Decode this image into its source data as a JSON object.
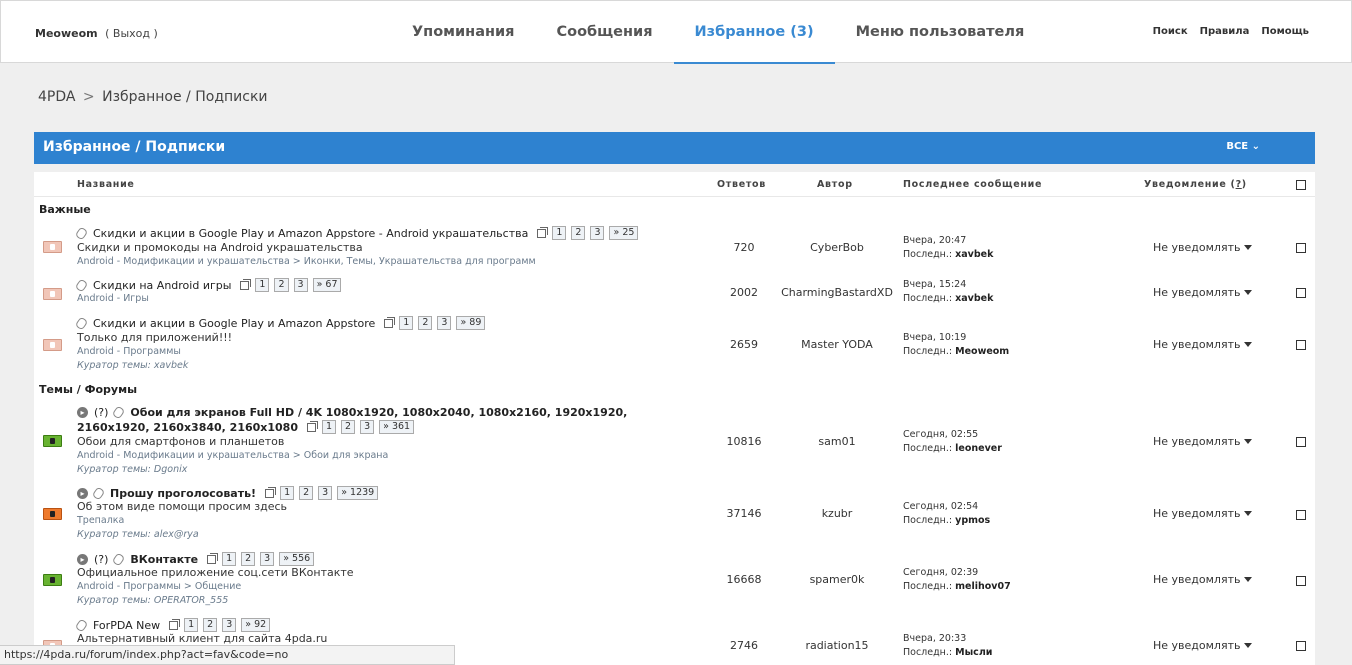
{
  "topbar": {
    "username": "Meoweom",
    "logout": "( Выход )",
    "tabs": [
      "Упоминания",
      "Сообщения",
      "Избранное (3)",
      "Меню пользователя"
    ],
    "active_tab": 2,
    "links": [
      "Поиск",
      "Правила",
      "Помощь"
    ]
  },
  "breadcrumb": {
    "root": "4PDA",
    "sep": ">",
    "current": "Избранное / Подписки"
  },
  "panel": {
    "title": "Избранное / Подписки",
    "filter": "ВСЕ"
  },
  "columns": {
    "name": "Название",
    "replies": "Ответов",
    "author": "Автор",
    "last": "Последнее сообщение",
    "notify": "Уведомление",
    "help": "?"
  },
  "sections": {
    "important": "Важные",
    "topics": "Темы / Форумы"
  },
  "labels": {
    "last_prefix": "Последн.:",
    "curator_prefix": "Куратор темы:"
  },
  "rows": [
    {
      "title": "Скидки и акции в Google Play и Amazon Appstore - Android украшательства",
      "pages": [
        "1",
        "2",
        "3",
        "» 25"
      ],
      "desc": "Скидки и промокоды на Android украшательства",
      "forum": "Android - Модификации и украшательства > Иконки, Темы, Украшательства для программ",
      "curator": "",
      "replies": "720",
      "author": "CyberBob",
      "last_time": "Вчера, 20:47",
      "last_user": "xavbek",
      "notify": "Не уведомлять"
    },
    {
      "title": "Скидки на Android игры",
      "pages": [
        "1",
        "2",
        "3",
        "» 67"
      ],
      "desc": "",
      "forum": "Android - Игры",
      "curator": "",
      "replies": "2002",
      "author": "CharmingBastardXD",
      "last_time": "Вчера, 15:24",
      "last_user": "xavbek",
      "notify": "Не уведомлять"
    },
    {
      "title": "Скидки и акции в Google Play и Amazon Appstore",
      "pages": [
        "1",
        "2",
        "3",
        "» 89"
      ],
      "desc": "Только для приложений!!!",
      "forum": "Android - Программы",
      "curator": "xavbek",
      "replies": "2659",
      "author": "Master YODA",
      "last_time": "Вчера, 10:19",
      "last_user": "Meoweom",
      "notify": "Не уведомлять"
    },
    {
      "title": "Обои для экранов Full HD / 4K 1080x1920, 1080x2040, 1080x2160, 1920x1920,",
      "title2": "2160x1920, 2160x3840, 2160x1080",
      "q": "(?)",
      "pages": [
        "1",
        "2",
        "3",
        "» 361"
      ],
      "desc": "Обои для смартфонов и планшетов",
      "forum": "Android - Модификации и украшательства > Обои для экрана",
      "curator": "Dgonix",
      "replies": "10816",
      "author": "sam01",
      "last_time": "Сегодня, 02:55",
      "last_user": "leonever",
      "notify": "Не уведомлять"
    },
    {
      "title": "Прошу проголосовать!",
      "pages": [
        "1",
        "2",
        "3",
        "» 1239"
      ],
      "desc": "Об этом виде помощи просим здесь",
      "forum": "Трепалка",
      "curator": "alex@rya",
      "replies": "37146",
      "author": "kzubr",
      "last_time": "Сегодня, 02:54",
      "last_user": "ypmos",
      "notify": "Не уведомлять"
    },
    {
      "title": "ВКонтакте",
      "q": "(?)",
      "pages": [
        "1",
        "2",
        "3",
        "» 556"
      ],
      "desc": "Официальное приложение соц.сети ВКонтакте",
      "forum": "Android - Программы > Общение",
      "curator": "OPERATOR_555",
      "replies": "16668",
      "author": "spamer0k",
      "last_time": "Сегодня, 02:39",
      "last_user": "melihov07",
      "notify": "Не уведомлять"
    },
    {
      "title": "ForPDA New",
      "pages": [
        "1",
        "2",
        "3",
        "» 92"
      ],
      "desc": "Альтернативный клиент для сайта 4pda.ru",
      "forum": "",
      "curator": "",
      "replies": "2746",
      "author": "radiation15",
      "last_time": "Вчера, 20:33",
      "last_user": "Мысли",
      "notify": "Не уведомлять"
    }
  ],
  "statusbar": "https://4pda.ru/forum/index.php?act=fav&code=no"
}
